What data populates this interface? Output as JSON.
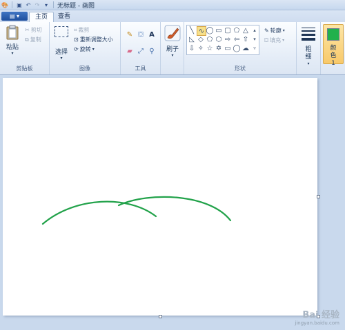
{
  "titlebar": {
    "title": "无标题 - 画图"
  },
  "tabs": {
    "home": "主页",
    "view": "查看"
  },
  "ribbon": {
    "clipboard": {
      "paste": "粘贴",
      "cut": "剪切",
      "copy": "复制",
      "label": "剪贴板"
    },
    "image": {
      "select": "选择",
      "crop": "裁剪",
      "resize": "重新调整大小",
      "rotate": "旋转",
      "label": "图像"
    },
    "tools": {
      "label": "工具"
    },
    "brushes": {
      "label": "刷子"
    },
    "shapes": {
      "outline": "轮廓",
      "fill": "填充",
      "label": "形状"
    },
    "size": {
      "label": "粗细"
    },
    "color1": {
      "label": "颜色 1",
      "color": "#22b14c"
    }
  },
  "canvas": {
    "stroke_color": "#22a24a"
  },
  "watermark": {
    "brand": "Bai 经验",
    "url": "jingyan.baidu.com"
  }
}
